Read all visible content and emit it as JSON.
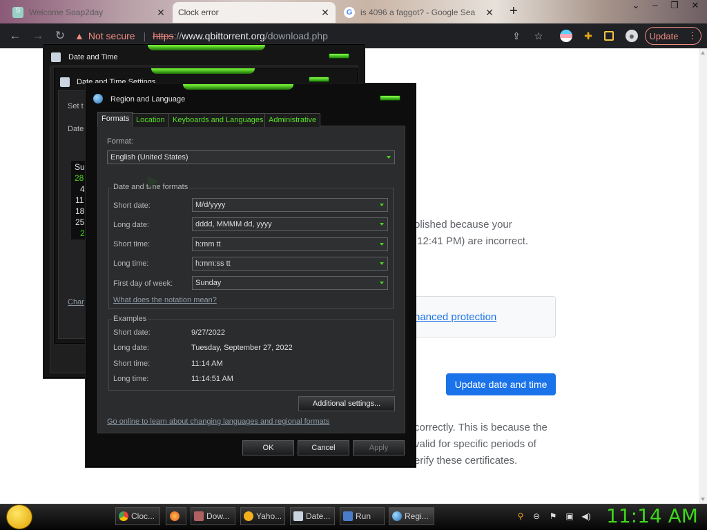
{
  "browser": {
    "tabs": [
      {
        "title": "Welcome Soap2day",
        "icon": "soap2day-favicon"
      },
      {
        "title": "Clock error",
        "icon": "blank-favicon"
      },
      {
        "title": "is 4096 a faggot? - Google Sea",
        "icon": "google-favicon"
      }
    ],
    "new_tab": "+",
    "window_controls": [
      "⌄",
      "–",
      "❐",
      "✕"
    ],
    "security_warning": "Not secure",
    "url_scheme": "https",
    "url_host": "www.qbittorrent.org",
    "url_path": "/download.php",
    "update_label": "Update"
  },
  "page": {
    "text1": "olished because your",
    "text2": ":12:41 PM) are incorrect.",
    "protection_link": "hanced protection",
    "update_button": "Update date and time",
    "text3": "correctly. This is because the",
    "text4": "valid for specific periods of",
    "text5": "erify these certificates."
  },
  "datetime_window": {
    "title": "Date and Time",
    "settings_title": "Date and Time Settings",
    "set_text": "Set t",
    "date_label": "Date",
    "calendar_header": "Su",
    "calendar_days": [
      "28",
      "4",
      "11",
      "18",
      "25",
      "2"
    ],
    "change_link": "Char"
  },
  "region_dialog": {
    "title": "Region and Language",
    "tabs": [
      "Formats",
      "Location",
      "Keyboards and Languages",
      "Administrative"
    ],
    "format_label": "Format:",
    "format_value": "English (United States)",
    "group_label": "Date and time formats",
    "fields": [
      {
        "label": "Short date:",
        "value": "M/d/yyyy"
      },
      {
        "label": "Long date:",
        "value": "dddd, MMMM dd, yyyy"
      },
      {
        "label": "Short time:",
        "value": "h:mm tt"
      },
      {
        "label": "Long time:",
        "value": "h:mm:ss tt"
      },
      {
        "label": "First day of week:",
        "value": "Sunday"
      }
    ],
    "notation_link": "What does the notation mean?",
    "examples_label": "Examples",
    "examples": [
      {
        "label": "Short date:",
        "value": "9/27/2022"
      },
      {
        "label": "Long date:",
        "value": "Tuesday, September 27, 2022"
      },
      {
        "label": "Short time:",
        "value": "11:14 AM"
      },
      {
        "label": "Long time:",
        "value": "11:14:51 AM"
      }
    ],
    "additional_settings": "Additional settings...",
    "online_link": "Go online to learn about changing languages and regional formats",
    "ok": "OK",
    "cancel": "Cancel",
    "apply": "Apply"
  },
  "taskbar": {
    "items": [
      "Cloc...",
      "",
      "Dow...",
      "Yaho...",
      "Date...",
      "Run",
      "Regi..."
    ],
    "clock": "11:14 AM"
  }
}
